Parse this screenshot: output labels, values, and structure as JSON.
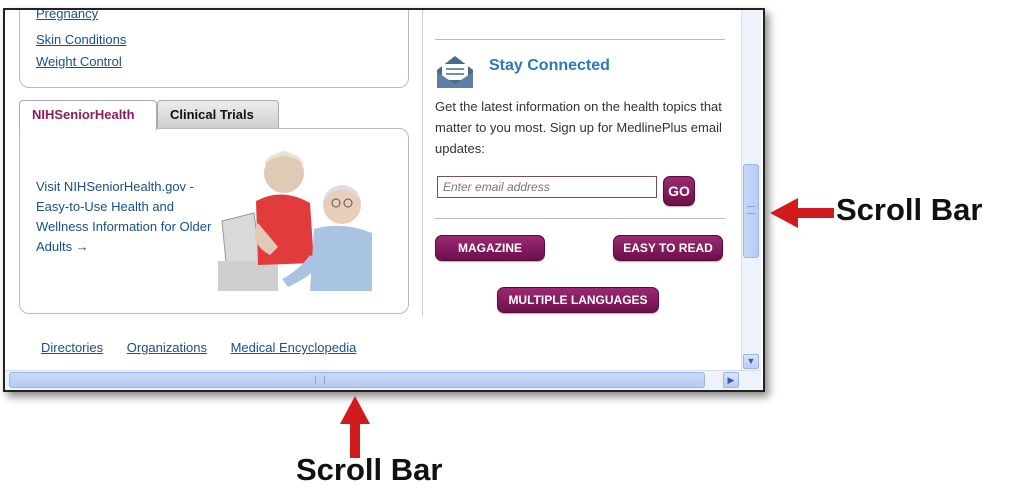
{
  "health_topics": {
    "partial_top": "Pregnancy",
    "links": [
      "Skin Conditions",
      "Weight Control"
    ]
  },
  "tabs": [
    {
      "label": "NIHSeniorHealth",
      "active": true
    },
    {
      "label": "Clinical Trials",
      "active": false
    }
  ],
  "senior_panel": {
    "text": "Visit NIHSeniorHealth.gov - Easy-to-Use Health and Wellness Information for Older Adults →"
  },
  "bottom_links": [
    "Directories",
    "Organizations",
    "Medical Encyclopedia"
  ],
  "stay_connected": {
    "title": "Stay Connected",
    "description": "Get the latest information on the health topics that matter to you most. Sign up for MedlinePlus email updates:",
    "email_placeholder": "Enter email address",
    "go_label": "GO"
  },
  "buttons": {
    "magazine": "MAGAZINE",
    "easy_to_read": "EASY TO READ",
    "multiple_languages": "MULTIPLE LANGUAGES"
  },
  "annotations": {
    "right_label": "Scroll Bar",
    "bottom_label": "Scroll Bar"
  },
  "colors": {
    "link": "#1a4f8a",
    "accent_purple": "#7a1453",
    "stay_title": "#2a7ab8",
    "annotation_arrow": "#d11a1a"
  },
  "icons": {
    "envelope": "newsletter-envelope-icon",
    "scroll_down": "chevron-down-icon",
    "scroll_right": "chevron-right-icon"
  }
}
